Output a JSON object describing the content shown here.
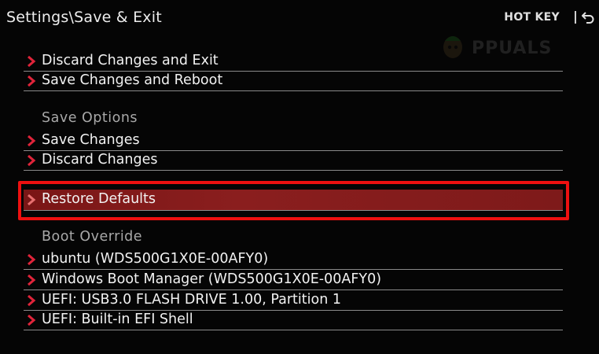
{
  "header": {
    "title": "Settings\\Save & Exit",
    "hotkey_label": "HOT KEY",
    "back_icon": "back-arrow-icon"
  },
  "watermark": {
    "text": "PPUALS"
  },
  "sections": {
    "save_exit": {
      "items": [
        {
          "label": "Discard Changes and Exit"
        },
        {
          "label": "Save Changes and Reboot"
        }
      ]
    },
    "save_options": {
      "heading": "Save Options",
      "items": [
        {
          "label": "Save Changes"
        },
        {
          "label": "Discard Changes"
        }
      ]
    },
    "restore": {
      "items": [
        {
          "label": "Restore Defaults",
          "selected": true
        }
      ]
    },
    "boot_override": {
      "heading": "Boot Override",
      "items": [
        {
          "label": "ubuntu (WDS500G1X0E-00AFY0)"
        },
        {
          "label": "Windows Boot Manager (WDS500G1X0E-00AFY0)"
        },
        {
          "label": "UEFI: USB3.0 FLASH DRIVE 1.00, Partition 1"
        },
        {
          "label": "UEFI: Built-in EFI Shell"
        }
      ]
    }
  },
  "colors": {
    "background": "#050505",
    "selected_row": "#7a1616",
    "highlight_box": "#ee1010",
    "chevron": "#e0243a",
    "heading_text": "#a8a8a8"
  }
}
